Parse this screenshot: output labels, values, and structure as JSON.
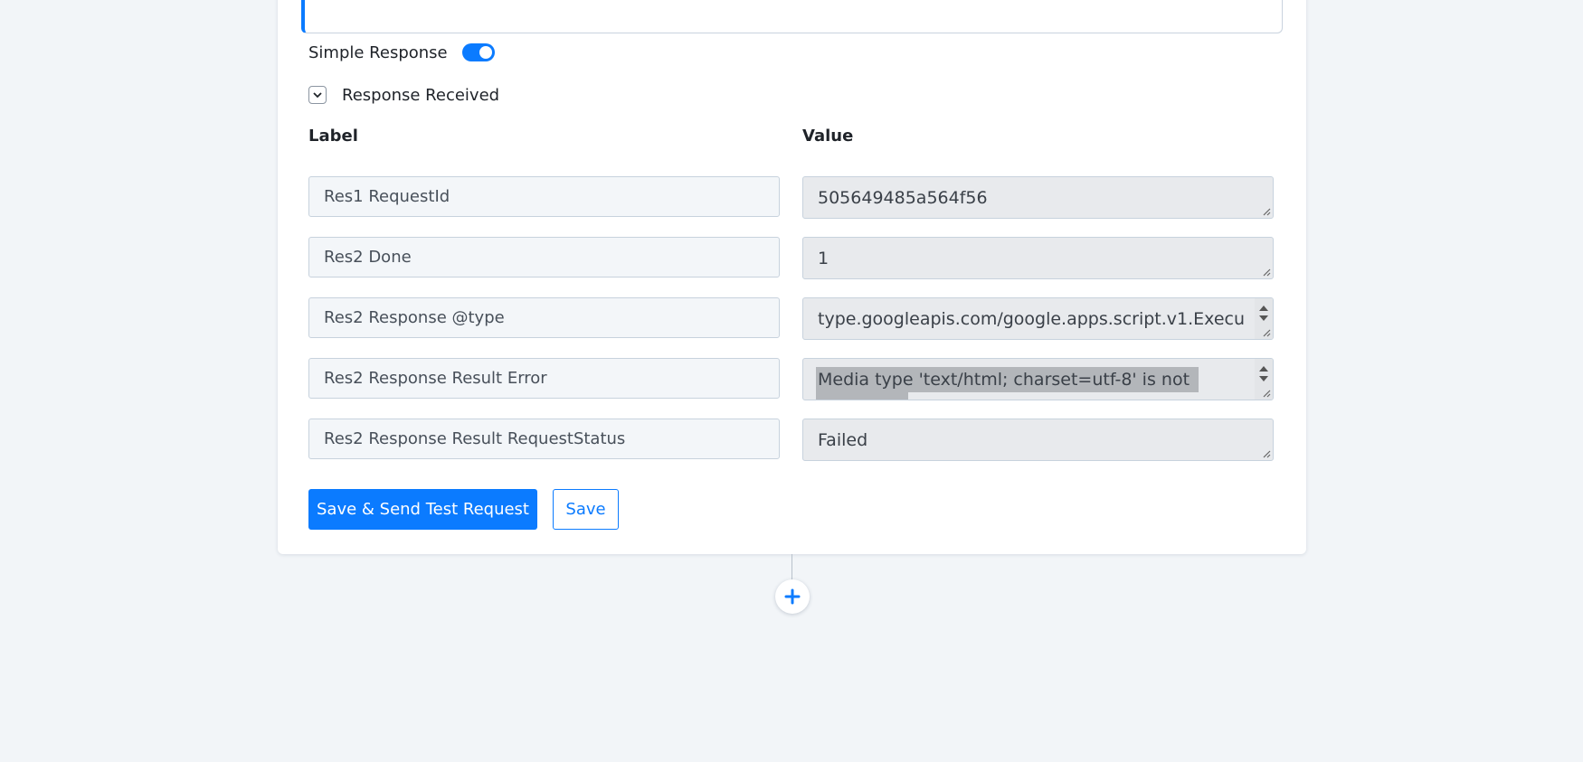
{
  "simple_response": {
    "label": "Simple Response",
    "enabled": true
  },
  "response_section": {
    "label": "Response Received",
    "expanded": true
  },
  "columns": {
    "label": "Label",
    "value": "Value"
  },
  "rows": [
    {
      "label": "Res1 RequestId",
      "value": "505649485a564f56"
    },
    {
      "label": "Res2 Done",
      "value": "1"
    },
    {
      "label": "Res2 Response @type",
      "value": "type.googleapis.com/google.apps.script.v1.Execu"
    },
    {
      "label": "Res2 Response Result Error",
      "value": "Media type 'text/html; charset=utf-8' is not"
    },
    {
      "label": "Res2 Response Result RequestStatus",
      "value": "Failed"
    }
  ],
  "buttons": {
    "save_send": "Save & Send Test Request",
    "save": "Save"
  },
  "icons": {
    "collapse": "chevron-down-icon",
    "add_step": "plus-icon",
    "resize": "resize-grip-icon"
  },
  "colors": {
    "accent": "#0b7bff",
    "background": "#f2f5f8"
  }
}
